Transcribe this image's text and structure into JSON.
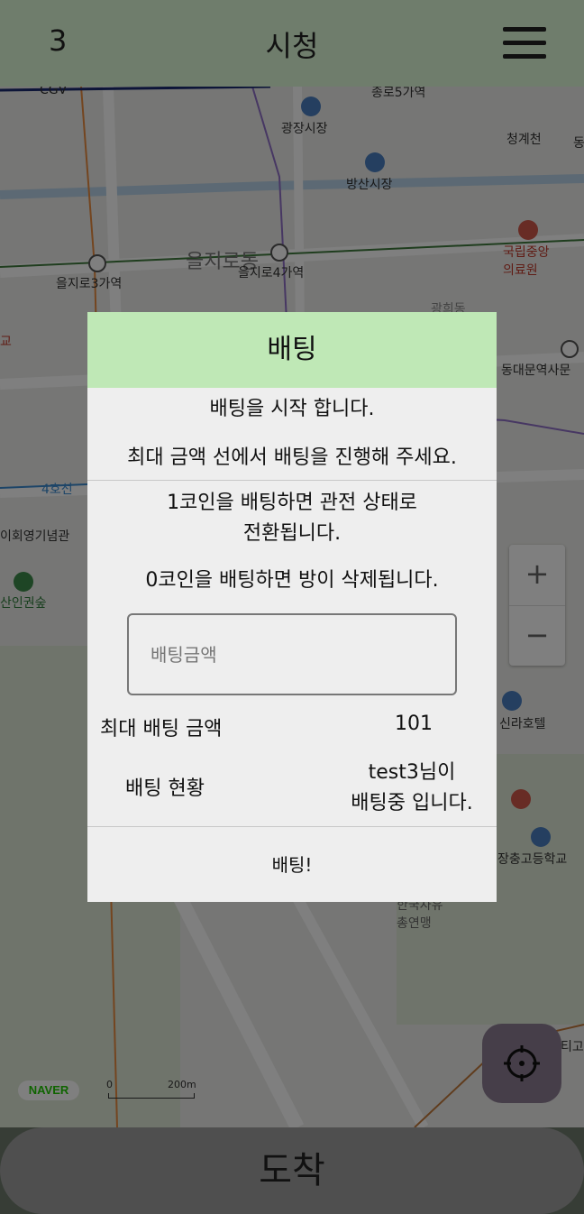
{
  "header": {
    "count": "3",
    "title": "시청"
  },
  "map": {
    "labels": {
      "cgv": "CGV",
      "jongno5": "종로5가역",
      "gwangjang": "광장시장",
      "cheonggyecheon": "청계천",
      "dong": "동",
      "bangsan": "방산시장",
      "euljiro_dong": "을지로동",
      "euljiro3": "을지로3가역",
      "euljiro4": "을지로4가역",
      "national_medical": "국립중앙\n의료원",
      "gwanghui": "광희동",
      "ddp": "동대문역사문",
      "line4": "4호선",
      "memorial": "이회영기념관",
      "namsan_forest": "산인권숲",
      "shilla": "신라호텔",
      "jangchung": "장충고등학교",
      "theater": "한국자유\n총연맹",
      "ti": "티고",
      "gyo": "교"
    },
    "logo": "NAVER",
    "scale": "200m",
    "scale_zero": "0",
    "zoom_in": "+",
    "zoom_out": "−"
  },
  "dialog": {
    "title": "배팅",
    "intro1": "배팅을 시작 합니다.",
    "intro2": "최대 금액 선에서 배팅을 진행해 주세요.",
    "info1": "1코인을 배팅하면 관전 상태로",
    "info1b": "전환됩니다.",
    "info2": "0코인을 배팅하면 방이 삭제됩니다.",
    "amount_placeholder": "배팅금액",
    "max_label": "최대 배팅 금액",
    "max_value": "101",
    "status_label": "배팅 현황",
    "status_value1": "test3님이",
    "status_value2": "배팅중 입니다.",
    "submit": "배팅!"
  },
  "bottom": {
    "arrive": "도착"
  },
  "colors": {
    "dialog_header": "#bfe8b6",
    "locate_button": "#8c7d92"
  },
  "icons": {
    "menu": "hamburger-menu-icon",
    "locate": "crosshair-icon"
  }
}
